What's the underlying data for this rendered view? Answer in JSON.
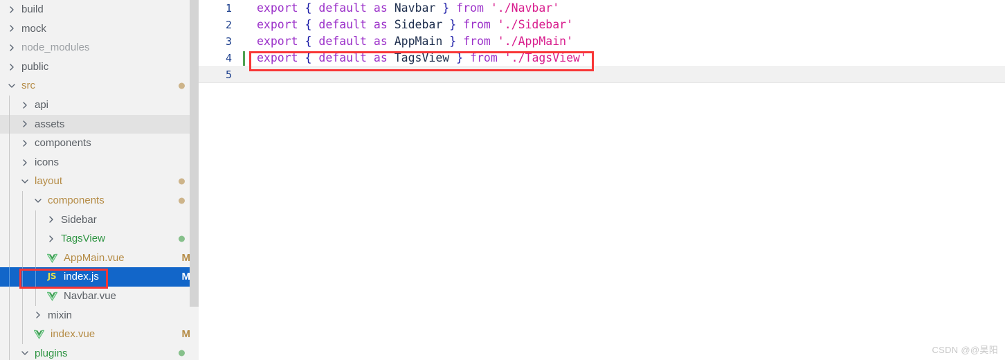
{
  "window": {
    "watermark": "CSDN @@昊阳"
  },
  "sidebar": {
    "name": "project-file-tree",
    "scrollbar": {
      "name": "sidebar-scrollbar"
    },
    "items": [
      {
        "label": "build",
        "kind": "folder",
        "expanded": false,
        "depth": 0,
        "state": "plain",
        "marker": "",
        "dot": ""
      },
      {
        "label": "mock",
        "kind": "folder",
        "expanded": false,
        "depth": 0,
        "state": "plain",
        "marker": "",
        "dot": ""
      },
      {
        "label": "node_modules",
        "kind": "folder",
        "expanded": false,
        "depth": 0,
        "state": "muted",
        "marker": "",
        "dot": ""
      },
      {
        "label": "public",
        "kind": "folder",
        "expanded": false,
        "depth": 0,
        "state": "plain",
        "marker": "",
        "dot": ""
      },
      {
        "label": "src",
        "kind": "folder",
        "expanded": true,
        "depth": 0,
        "state": "mod",
        "marker": "",
        "dot": "mod"
      },
      {
        "label": "api",
        "kind": "folder",
        "expanded": false,
        "depth": 1,
        "state": "plain",
        "marker": "",
        "dot": ""
      },
      {
        "label": "assets",
        "kind": "folder",
        "expanded": false,
        "depth": 1,
        "state": "plain",
        "marker": "",
        "dot": "",
        "hover": true
      },
      {
        "label": "components",
        "kind": "folder",
        "expanded": false,
        "depth": 1,
        "state": "plain",
        "marker": "",
        "dot": ""
      },
      {
        "label": "icons",
        "kind": "folder",
        "expanded": false,
        "depth": 1,
        "state": "plain",
        "marker": "",
        "dot": ""
      },
      {
        "label": "layout",
        "kind": "folder",
        "expanded": true,
        "depth": 1,
        "state": "mod",
        "marker": "",
        "dot": "mod"
      },
      {
        "label": "components",
        "kind": "folder",
        "expanded": true,
        "depth": 2,
        "state": "mod",
        "marker": "",
        "dot": "mod"
      },
      {
        "label": "Sidebar",
        "kind": "folder",
        "expanded": false,
        "depth": 3,
        "state": "plain",
        "marker": "",
        "dot": ""
      },
      {
        "label": "TagsView",
        "kind": "folder",
        "expanded": false,
        "depth": 3,
        "state": "new",
        "marker": "",
        "dot": "new"
      },
      {
        "label": "AppMain.vue",
        "kind": "vue",
        "expanded": null,
        "depth": 3,
        "state": "mod",
        "marker": "M",
        "dot": ""
      },
      {
        "label": "index.js",
        "kind": "js",
        "expanded": null,
        "depth": 3,
        "state": "sel",
        "marker": "M",
        "dot": "",
        "selected": true
      },
      {
        "label": "Navbar.vue",
        "kind": "vue",
        "expanded": null,
        "depth": 3,
        "state": "plain",
        "marker": "",
        "dot": ""
      },
      {
        "label": "mixin",
        "kind": "folder",
        "expanded": false,
        "depth": 2,
        "state": "plain",
        "marker": "",
        "dot": ""
      },
      {
        "label": "index.vue",
        "kind": "vue",
        "expanded": null,
        "depth": 2,
        "state": "mod",
        "marker": "M",
        "dot": ""
      },
      {
        "label": "plugins",
        "kind": "folder",
        "expanded": true,
        "depth": 1,
        "state": "new",
        "marker": "",
        "dot": "new"
      }
    ]
  },
  "editor": {
    "name": "code-editor",
    "language": "javascript",
    "current_line": 5,
    "lines": [
      {
        "number": "1",
        "changed": false,
        "tokens": [
          {
            "t": "export",
            "c": "k"
          },
          {
            "t": " ",
            "c": "p"
          },
          {
            "t": "{",
            "c": "b"
          },
          {
            "t": " ",
            "c": "p"
          },
          {
            "t": "default",
            "c": "k"
          },
          {
            "t": " ",
            "c": "p"
          },
          {
            "t": "as",
            "c": "k"
          },
          {
            "t": " ",
            "c": "p"
          },
          {
            "t": "Navbar",
            "c": "id"
          },
          {
            "t": " ",
            "c": "p"
          },
          {
            "t": "}",
            "c": "b"
          },
          {
            "t": " ",
            "c": "p"
          },
          {
            "t": "from",
            "c": "k"
          },
          {
            "t": " ",
            "c": "p"
          },
          {
            "t": "'./Navbar'",
            "c": "s"
          }
        ]
      },
      {
        "number": "2",
        "changed": false,
        "tokens": [
          {
            "t": "export",
            "c": "k"
          },
          {
            "t": " ",
            "c": "p"
          },
          {
            "t": "{",
            "c": "b"
          },
          {
            "t": " ",
            "c": "p"
          },
          {
            "t": "default",
            "c": "k"
          },
          {
            "t": " ",
            "c": "p"
          },
          {
            "t": "as",
            "c": "k"
          },
          {
            "t": " ",
            "c": "p"
          },
          {
            "t": "Sidebar",
            "c": "id"
          },
          {
            "t": " ",
            "c": "p"
          },
          {
            "t": "}",
            "c": "b"
          },
          {
            "t": " ",
            "c": "p"
          },
          {
            "t": "from",
            "c": "k"
          },
          {
            "t": " ",
            "c": "p"
          },
          {
            "t": "'./Sidebar'",
            "c": "s"
          }
        ]
      },
      {
        "number": "3",
        "changed": false,
        "tokens": [
          {
            "t": "export",
            "c": "k"
          },
          {
            "t": " ",
            "c": "p"
          },
          {
            "t": "{",
            "c": "b"
          },
          {
            "t": " ",
            "c": "p"
          },
          {
            "t": "default",
            "c": "k"
          },
          {
            "t": " ",
            "c": "p"
          },
          {
            "t": "as",
            "c": "k"
          },
          {
            "t": " ",
            "c": "p"
          },
          {
            "t": "AppMain",
            "c": "id"
          },
          {
            "t": " ",
            "c": "p"
          },
          {
            "t": "}",
            "c": "b"
          },
          {
            "t": " ",
            "c": "p"
          },
          {
            "t": "from",
            "c": "k"
          },
          {
            "t": " ",
            "c": "p"
          },
          {
            "t": "'./AppMain'",
            "c": "s"
          }
        ]
      },
      {
        "number": "4",
        "changed": true,
        "tokens": [
          {
            "t": "export",
            "c": "k"
          },
          {
            "t": " ",
            "c": "p"
          },
          {
            "t": "{",
            "c": "b"
          },
          {
            "t": " ",
            "c": "p"
          },
          {
            "t": "default",
            "c": "k"
          },
          {
            "t": " ",
            "c": "p"
          },
          {
            "t": "as",
            "c": "k"
          },
          {
            "t": " ",
            "c": "p"
          },
          {
            "t": "TagsView",
            "c": "id"
          },
          {
            "t": " ",
            "c": "p"
          },
          {
            "t": "}",
            "c": "b"
          },
          {
            "t": " ",
            "c": "p"
          },
          {
            "t": "from",
            "c": "k"
          },
          {
            "t": " ",
            "c": "p"
          },
          {
            "t": "'./TagsView'",
            "c": "s"
          }
        ]
      },
      {
        "number": "5",
        "changed": false,
        "tokens": []
      }
    ]
  },
  "annotations": [
    {
      "name": "code-highlight-box",
      "color": "#f83636",
      "target": "line-4"
    },
    {
      "name": "file-highlight-box",
      "color": "#f83636",
      "target": "index.js"
    }
  ],
  "colors": {
    "selection": "#1266c9",
    "modified": "#b58c46",
    "new": "#2e9442",
    "annotation": "#f83636",
    "sidebar_bg": "#f2f2f2"
  }
}
